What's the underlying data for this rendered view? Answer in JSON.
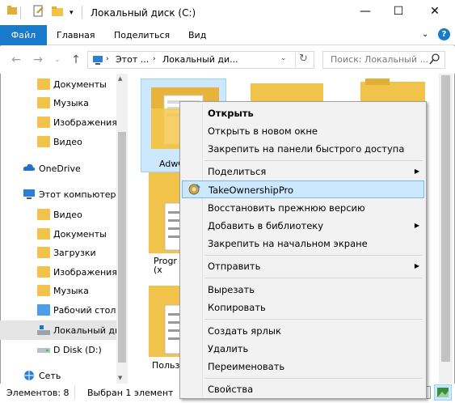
{
  "window": {
    "title": "Локальный диск (C:)",
    "controls": {
      "minimize": "—",
      "maximize": "☐",
      "close": "✕"
    }
  },
  "ribbon": {
    "tabs": [
      "Файл",
      "Главная",
      "Поделиться",
      "Вид"
    ],
    "help": "?"
  },
  "address": {
    "crumbs": [
      "Этот ...",
      "Локальный ди..."
    ],
    "search_placeholder": "Поиск: Локальный ..."
  },
  "nav": {
    "items": [
      {
        "label": "Документы",
        "icon": "documents-folder-icon"
      },
      {
        "label": "Музыка",
        "icon": "music-folder-icon"
      },
      {
        "label": "Изображения",
        "icon": "pictures-folder-icon"
      },
      {
        "label": "Видео",
        "icon": "video-folder-icon"
      },
      {
        "label": "OneDrive",
        "icon": "onedrive-icon"
      },
      {
        "label": "Этот компьютер",
        "icon": "computer-icon"
      },
      {
        "label": "Видео",
        "icon": "video-folder-icon"
      },
      {
        "label": "Документы",
        "icon": "documents-folder-icon"
      },
      {
        "label": "Загрузки",
        "icon": "downloads-folder-icon"
      },
      {
        "label": "Изображения",
        "icon": "pictures-folder-icon"
      },
      {
        "label": "Музыка",
        "icon": "music-folder-icon"
      },
      {
        "label": "Рабочий стол",
        "icon": "desktop-folder-icon"
      },
      {
        "label": "Локальный ди",
        "icon": "local-disk-icon"
      },
      {
        "label": "D Disk (D:)",
        "icon": "disk-icon"
      },
      {
        "label": "Сеть",
        "icon": "network-icon"
      }
    ]
  },
  "content": {
    "items": [
      {
        "label": "AdwC"
      },
      {
        "label": "Progr\n(x"
      },
      {
        "label": "Польз"
      }
    ]
  },
  "status": {
    "count": "Элементов: 8",
    "selected": "Выбран 1 элемент"
  },
  "context_menu": {
    "items": [
      {
        "label": "Открыть",
        "bold": true
      },
      {
        "label": "Открыть в новом окне"
      },
      {
        "label": "Закрепить на панели быстрого доступа"
      },
      {
        "label": "Поделиться",
        "submenu": true
      },
      {
        "label": "TakeOwnershipPro",
        "highlighted": true,
        "icon": "takeownership-gear-icon"
      },
      {
        "label": "Восстановить прежнюю версию"
      },
      {
        "label": "Добавить в библиотеку",
        "submenu": true
      },
      {
        "label": "Закрепить на начальном экране"
      },
      {
        "label": "Отправить",
        "submenu": true
      },
      {
        "label": "Вырезать"
      },
      {
        "label": "Копировать"
      },
      {
        "label": "Создать ярлык"
      },
      {
        "label": "Удалить"
      },
      {
        "label": "Переименовать"
      },
      {
        "label": "Свойства"
      }
    ],
    "submenu_arrow": "▶"
  },
  "colors": {
    "file_tab": "#1979ca",
    "highlight_bg": "#cce8ff",
    "highlight_border": "#7ab8e8",
    "folder": "#f2c34b",
    "selection": "#cce8ff"
  }
}
